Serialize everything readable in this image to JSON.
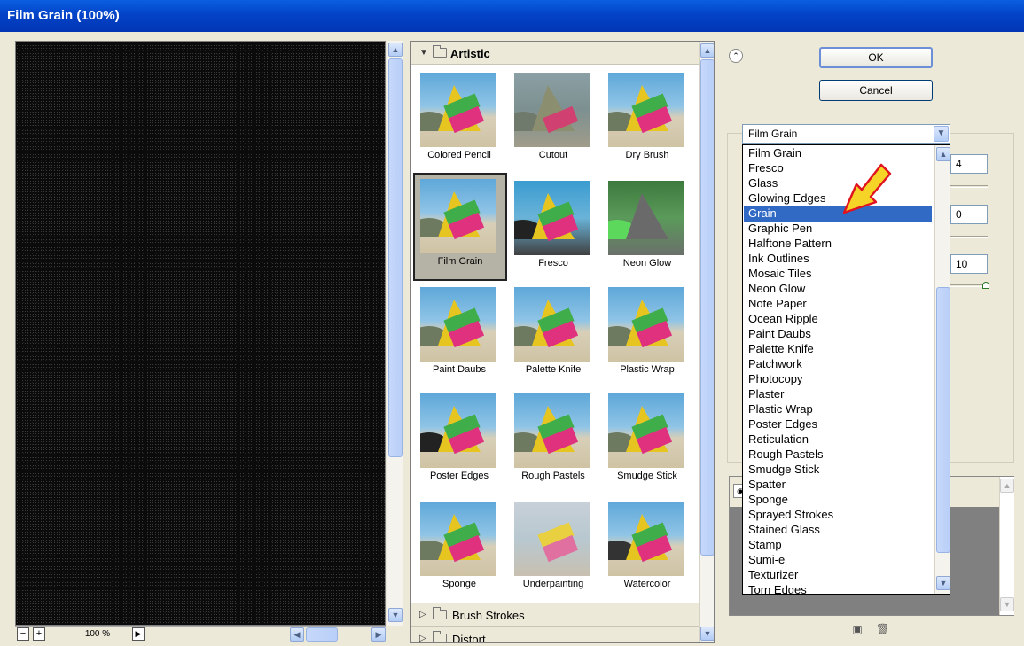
{
  "window": {
    "title": "Film Grain (100%)"
  },
  "preview": {
    "zoom_label": "100 %",
    "zoom_out": "−",
    "zoom_in": "+"
  },
  "gallery": {
    "categories": {
      "artistic": "Artistic",
      "brush_strokes": "Brush Strokes",
      "distort": "Distort"
    },
    "tiles": [
      "Colored Pencil",
      "Cutout",
      "Dry Brush",
      "Film Grain",
      "Fresco",
      "Neon Glow",
      "Paint Daubs",
      "Palette Knife",
      "Plastic Wrap",
      "Poster Edges",
      "Rough Pastels",
      "Smudge Stick",
      "Sponge",
      "Underpainting",
      "Watercolor"
    ],
    "selected_tile": "Film Grain"
  },
  "buttons": {
    "ok": "OK",
    "cancel": "Cancel"
  },
  "filter_select": {
    "value": "Film Grain",
    "options": [
      "Film Grain",
      "Fresco",
      "Glass",
      "Glowing Edges",
      "Grain",
      "Graphic Pen",
      "Halftone Pattern",
      "Ink Outlines",
      "Mosaic Tiles",
      "Neon Glow",
      "Note Paper",
      "Ocean Ripple",
      "Paint Daubs",
      "Palette Knife",
      "Patchwork",
      "Photocopy",
      "Plaster",
      "Plastic Wrap",
      "Poster Edges",
      "Reticulation",
      "Rough Pastels",
      "Smudge Stick",
      "Spatter",
      "Sponge",
      "Sprayed Strokes",
      "Stained Glass",
      "Stamp",
      "Sumi-e",
      "Texturizer",
      "Torn Edges"
    ],
    "highlighted": "Grain"
  },
  "params": {
    "grain": "4",
    "highlight_area": "0",
    "intensity": "10"
  },
  "colors": {
    "titlebar": "#0343c8",
    "highlight": "#316ac5",
    "arrow": "#f5d327"
  }
}
